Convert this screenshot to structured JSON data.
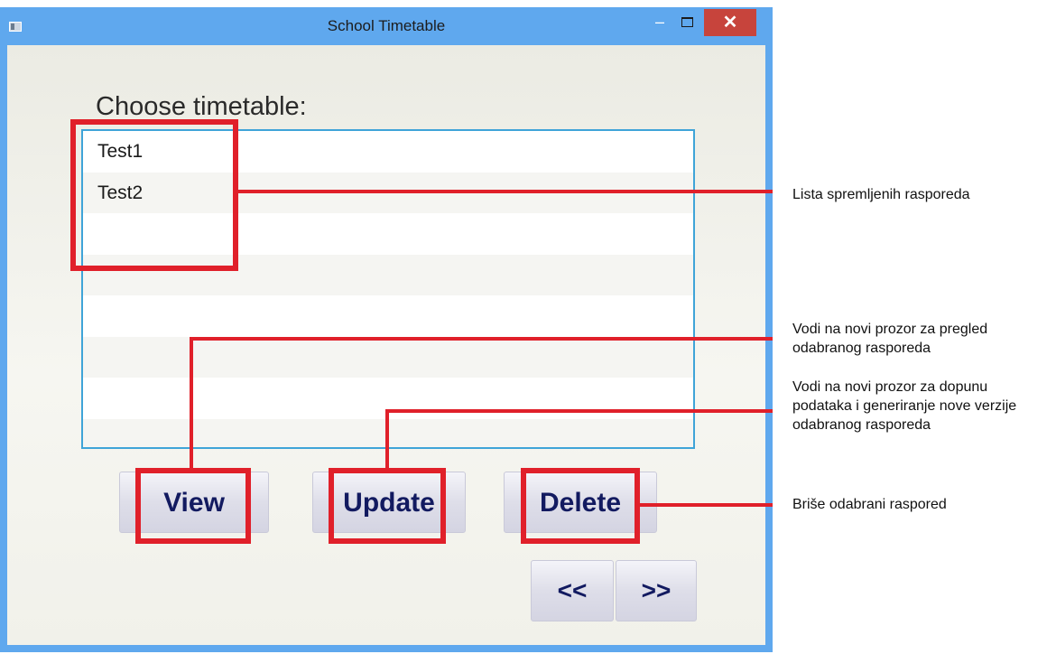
{
  "window": {
    "title": "School Timetable",
    "min_glyph": "–",
    "close_glyph": "✕"
  },
  "main": {
    "heading": "Choose timetable:",
    "list_items": [
      "Test1",
      "Test2",
      "",
      "",
      "",
      "",
      "",
      ""
    ]
  },
  "buttons": {
    "view": "View",
    "update": "Update",
    "delete": "Delete",
    "prev": "<<",
    "next": ">>"
  },
  "annotations": {
    "list": "Lista spremljenih rasporeda",
    "view": "Vodi na novi prozor za pregled odabranog rasporeda",
    "update": "Vodi na novi prozor za dopunu podataka i generiranje nove verzije odabranog rasporeda",
    "delete": "Briše odabrani raspored"
  },
  "colors": {
    "highlight": "#e0202a",
    "titlebar": "#5fa8ee",
    "close_button": "#c7443c",
    "button_text": "#121a60",
    "list_border": "#3fa4d8"
  }
}
